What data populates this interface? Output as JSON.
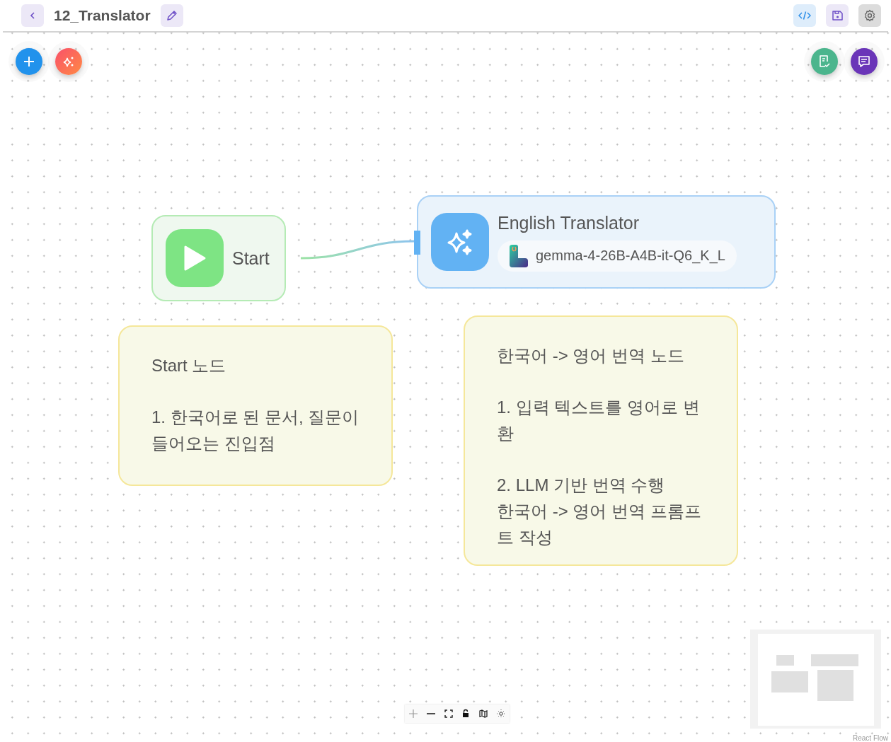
{
  "header": {
    "title": "12_Translator"
  },
  "nodes": [
    {
      "kind": "start",
      "title": "Start"
    },
    {
      "kind": "llm",
      "title": "English Translator",
      "model": "gemma-4-26B-A4B-it-Q6_K_L"
    }
  ],
  "notes": [
    {
      "paragraphs": [
        [
          "Start 노드"
        ],
        [
          "1. 한국어로 된 문서, 질문이 들어오는 진입점"
        ]
      ]
    },
    {
      "paragraphs": [
        [
          "한국어 -> 영어 번역 노드"
        ],
        [
          "1. 입력 텍스트를 영어로 변환"
        ],
        [
          "2. LLM 기반 번역 수행",
          "한국어 -> 영어 번역 프롬프트 작성"
        ]
      ]
    }
  ],
  "attribution": "React Flow"
}
